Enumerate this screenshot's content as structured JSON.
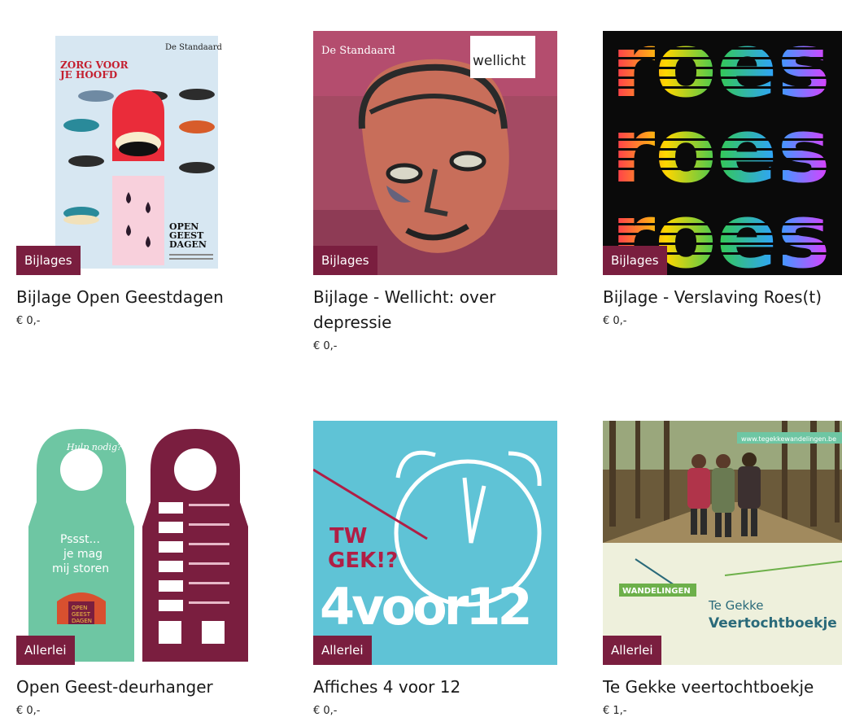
{
  "products": [
    {
      "badge": "Bijlages",
      "title": "Bijlage Open Geestdagen",
      "price": "€ 0,-",
      "image": {
        "masthead": "De Standaard",
        "headline_line1": "ZORG VOOR",
        "headline_line2": "JE HOOFD",
        "footer_line1": "OPEN",
        "footer_line2": "GEEST",
        "footer_line3": "DAGEN"
      }
    },
    {
      "badge": "Bijlages",
      "title": "Bijlage - Wellicht: over depressie",
      "price": "€ 0,-",
      "image": {
        "masthead": "De Standaard",
        "logo": "wellicht"
      }
    },
    {
      "badge": "Bijlages",
      "title": "Bijlage - Verslaving Roes(t)",
      "price": "€ 0,-",
      "image": {
        "word": "roes"
      }
    },
    {
      "badge": "Allerlei",
      "title": "Open Geest-deurhanger",
      "price": "€ 0,-",
      "image": {
        "hanger_tag": "Hulp nodig?",
        "text_line1": "Pssst...",
        "text_line2": "je mag",
        "text_line3": "mij storen",
        "logo_line1": "OPEN",
        "logo_line2": "GEEST",
        "logo_line3": "DAGEN"
      }
    },
    {
      "badge": "Allerlei",
      "title": "Affiches 4 voor 12",
      "price": "€ 0,-",
      "image": {
        "logo_line1": "TW",
        "logo_line2": "GEK!?",
        "big_text": "4voor12"
      }
    },
    {
      "badge": "Allerlei",
      "title": "Te Gekke veertochtboekje",
      "price": "€ 1,-",
      "image": {
        "url_text": "www.tegekkewandelingen.be",
        "ribbon": "WANDELINGEN",
        "line1": "Te Gekke",
        "line2": "Veertochtboekje"
      }
    }
  ],
  "colors": {
    "badge": "#7a1e3f",
    "teal": "#6ec6a3",
    "maroon": "#7a1e3f",
    "sky": "#5fc3d6"
  }
}
